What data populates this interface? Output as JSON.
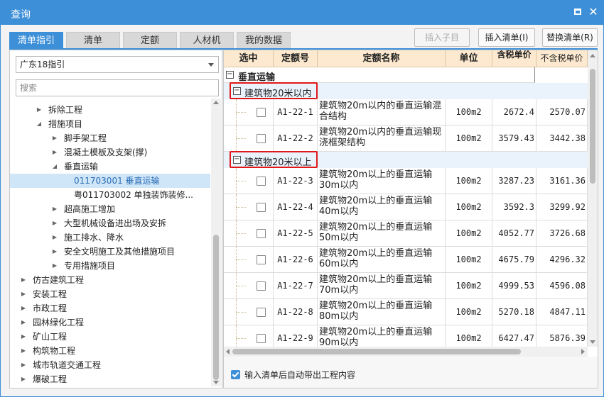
{
  "window": {
    "title": "查询"
  },
  "tabs": [
    "清单指引",
    "清单",
    "定额",
    "人材机",
    "我的数据"
  ],
  "buttons": {
    "insert_child": "插入子目",
    "insert_list": "插入清单(I)",
    "replace_list": "替换清单(R)"
  },
  "left": {
    "selected_value": "广东18指引",
    "search_placeholder": "搜索",
    "tree": [
      {
        "label": "拆除工程",
        "level": 2,
        "toggle": "collapsed"
      },
      {
        "label": "措施项目",
        "level": 2,
        "toggle": "expanded"
      },
      {
        "label": "脚手架工程",
        "level": 3,
        "toggle": "collapsed"
      },
      {
        "label": "混凝土模板及支架(撑)",
        "level": 3,
        "toggle": "collapsed"
      },
      {
        "label": "垂直运输",
        "level": 3,
        "toggle": "expanded"
      },
      {
        "label": "011703001  垂直运输",
        "level": 4,
        "toggle": "none",
        "selected": true
      },
      {
        "label": "粤011703002  单独装饰装修...",
        "level": 4,
        "toggle": "none"
      },
      {
        "label": "超高施工增加",
        "level": 3,
        "toggle": "collapsed"
      },
      {
        "label": "大型机械设备进出场及安拆",
        "level": 3,
        "toggle": "collapsed"
      },
      {
        "label": "施工排水、降水",
        "level": 3,
        "toggle": "collapsed"
      },
      {
        "label": "安全文明施工及其他措施项目",
        "level": 3,
        "toggle": "collapsed"
      },
      {
        "label": "专用措施项目",
        "level": 3,
        "toggle": "collapsed"
      },
      {
        "label": "仿古建筑工程",
        "level": 1,
        "toggle": "collapsed"
      },
      {
        "label": "安装工程",
        "level": 1,
        "toggle": "collapsed"
      },
      {
        "label": "市政工程",
        "level": 1,
        "toggle": "collapsed"
      },
      {
        "label": "园林绿化工程",
        "level": 1,
        "toggle": "collapsed"
      },
      {
        "label": "矿山工程",
        "level": 1,
        "toggle": "collapsed"
      },
      {
        "label": "构筑物工程",
        "level": 1,
        "toggle": "collapsed"
      },
      {
        "label": "城市轨道交通工程",
        "level": 1,
        "toggle": "collapsed"
      },
      {
        "label": "爆破工程",
        "level": 1,
        "toggle": "collapsed"
      }
    ]
  },
  "grid": {
    "headers": {
      "select": "选中",
      "code": "定额号",
      "name": "定额名称",
      "unit": "单位",
      "tax_price": "含税单价",
      "notax_price": "不含税单价"
    },
    "group_root": "垂直运输",
    "groups": [
      {
        "label": "建筑物20米以内",
        "rows": [
          {
            "code": "A1-22-1",
            "name": "建筑物20m以内的垂直运输混合结构",
            "unit": "100m2",
            "tax_price": "2672.4",
            "notax_price": "2570.07"
          },
          {
            "code": "A1-22-2",
            "name": "建筑物20m以内的垂直运输现浇框架结构",
            "unit": "100m2",
            "tax_price": "3579.43",
            "notax_price": "3442.38"
          }
        ]
      },
      {
        "label": "建筑物20米以上",
        "rows": [
          {
            "code": "A1-22-3",
            "name": "建筑物20m以上的垂直运输30m以内",
            "unit": "100m2",
            "tax_price": "3287.23",
            "notax_price": "3161.36"
          },
          {
            "code": "A1-22-4",
            "name": "建筑物20m以上的垂直运输40m以内",
            "unit": "100m2",
            "tax_price": "3592.3",
            "notax_price": "3299.92"
          },
          {
            "code": "A1-22-5",
            "name": "建筑物20m以上的垂直运输50m以内",
            "unit": "100m2",
            "tax_price": "4052.77",
            "notax_price": "3726.68"
          },
          {
            "code": "A1-22-6",
            "name": "建筑物20m以上的垂直运输60m以内",
            "unit": "100m2",
            "tax_price": "4675.79",
            "notax_price": "4296.32"
          },
          {
            "code": "A1-22-7",
            "name": "建筑物20m以上的垂直运输70m以内",
            "unit": "100m2",
            "tax_price": "4999.53",
            "notax_price": "4596.08"
          },
          {
            "code": "A1-22-8",
            "name": "建筑物20m以上的垂直运输80m以内",
            "unit": "100m2",
            "tax_price": "5270.18",
            "notax_price": "4847.11"
          },
          {
            "code": "A1-22-9",
            "name": "建筑物20m以上的垂直运输90m以内",
            "unit": "100m2",
            "tax_price": "6427.47",
            "notax_price": "5876.39"
          }
        ]
      }
    ]
  },
  "footer": {
    "auto_bring_label": "输入清单后自动带出工程内容",
    "checked": true
  },
  "colors": {
    "accent": "#3d8fd8",
    "header_bg": "#fde9cf",
    "group_bg": "#eaf3fc",
    "highlight": "#e01818"
  }
}
